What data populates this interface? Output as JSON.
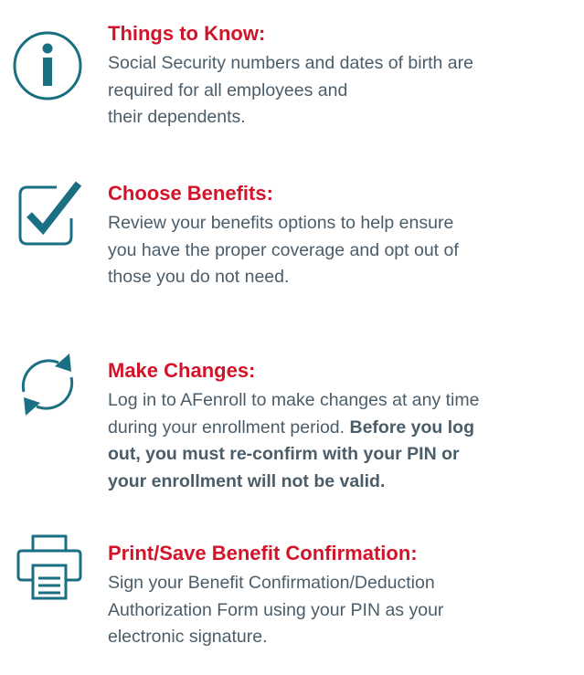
{
  "sections": [
    {
      "title": "Things to Know:",
      "lines": [
        "Social Security numbers and dates of birth are",
        "required for all employees and",
        "their dependents."
      ]
    },
    {
      "title": "Choose Benefits:",
      "lines": [
        "Review your benefits options to help ensure",
        "you have the proper coverage and opt out of",
        "those you do not need."
      ]
    },
    {
      "title": "Make Changes:",
      "line1": "Log in to AFenroll to make changes at any time",
      "line2_plain": "during your enrollment period. ",
      "line2_bold": "Before you log",
      "line3_bold": "out, you must re-confirm with your PIN or",
      "line4_bold": "your enrollment will not be valid."
    },
    {
      "title": "Print/Save Benefit Confirmation:",
      "lines": [
        "Sign your Benefit Confirmation/Deduction",
        "Authorization Form using your PIN as your",
        "electronic signature."
      ]
    }
  ],
  "colors": {
    "title": "#d2142a",
    "text": "#4b5d69",
    "icon": "#1b6f82"
  },
  "icons": [
    "info-icon",
    "checkmark-icon",
    "refresh-icon",
    "printer-icon"
  ]
}
